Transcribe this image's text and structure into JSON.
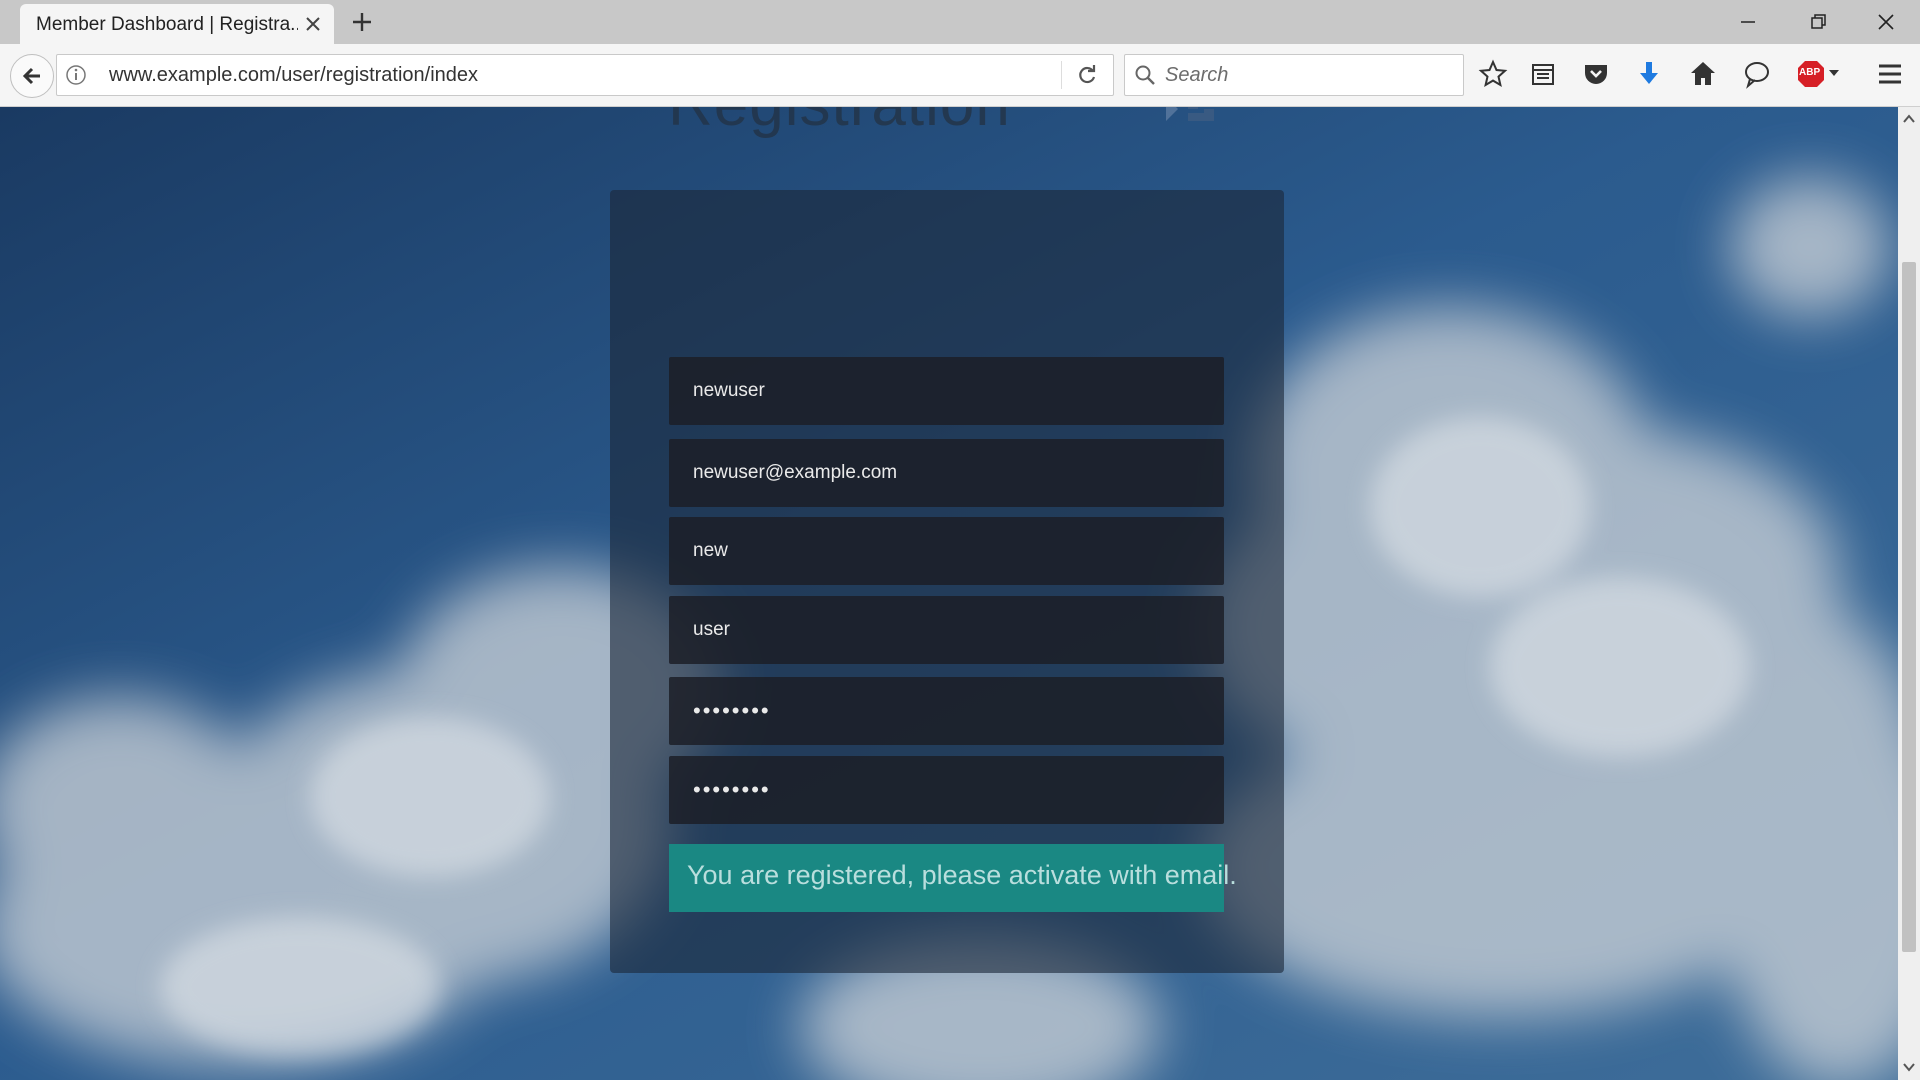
{
  "browser": {
    "tab_title": "Member Dashboard | Registra...",
    "url": "www.example.com/user/registration/index",
    "search_placeholder": "Search",
    "abp_badge": "ABP"
  },
  "page": {
    "heading": "Registration",
    "form": {
      "username": "newuser",
      "email": "newuser@example.com",
      "first_name": "new",
      "last_name": "user",
      "password": "••••••••",
      "confirm_password": "••••••••"
    },
    "notice": "You are registered, please activate with email."
  },
  "colors": {
    "notice_bg": "#1a8883",
    "field_bg": "#1c1e26",
    "download_arrow": "#1e7ae0",
    "abp_red": "#d61f26"
  },
  "icons": [
    "back-arrow-icon",
    "info-icon",
    "reload-icon",
    "search-icon",
    "star-icon",
    "reading-list-icon",
    "pocket-icon",
    "download-icon",
    "home-icon",
    "chat-icon",
    "adblock-icon",
    "menu-icon",
    "close-icon",
    "plus-icon",
    "minimize-icon",
    "restore-icon"
  ]
}
